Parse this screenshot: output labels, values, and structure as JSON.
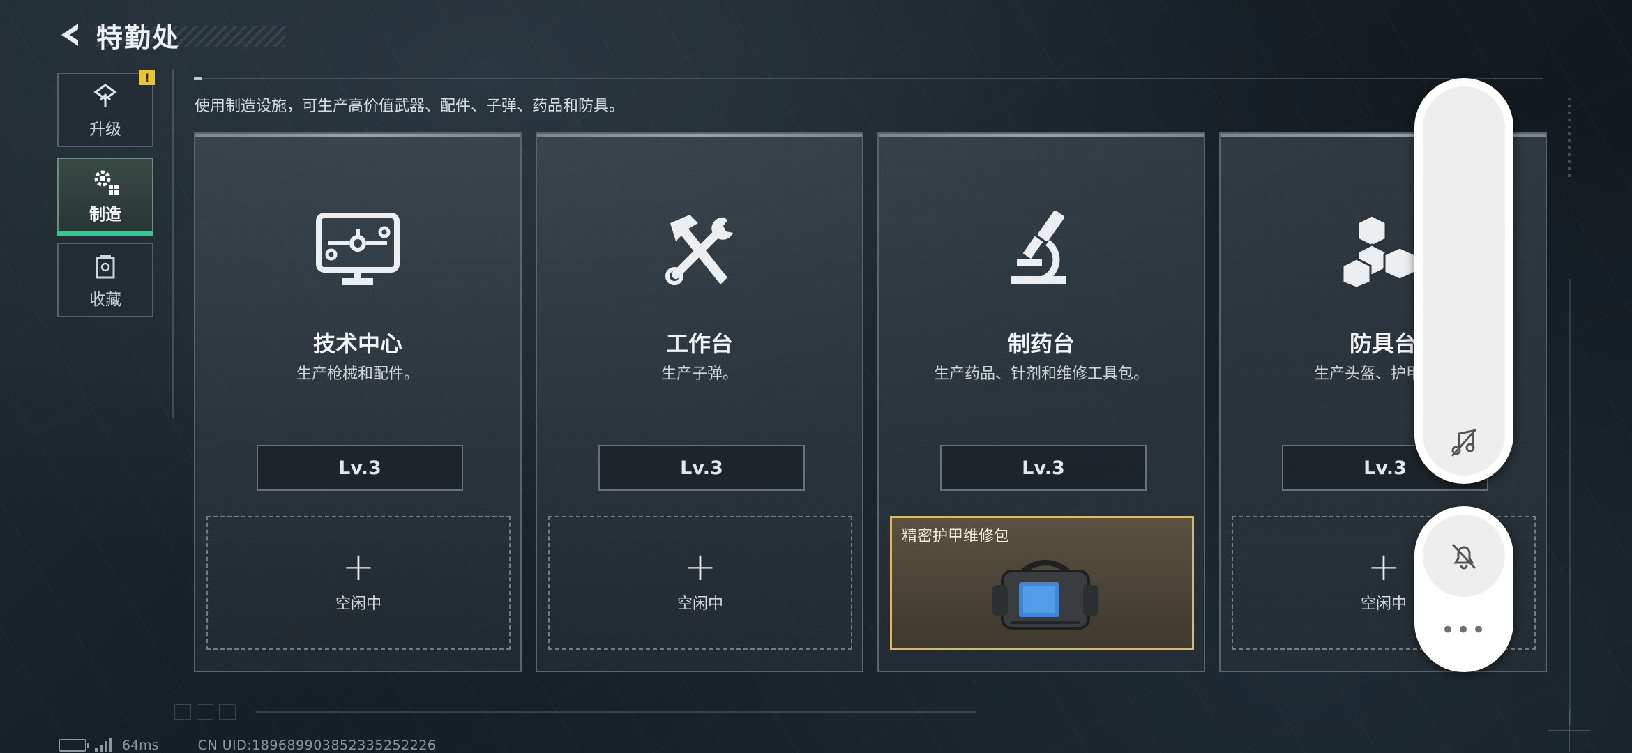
{
  "header": {
    "title": "特勤处"
  },
  "sidebar": {
    "items": [
      {
        "label": "升级",
        "icon": "upgrade-icon",
        "badge": "!",
        "active": false
      },
      {
        "label": "制造",
        "icon": "gear-icon",
        "active": true
      },
      {
        "label": "收藏",
        "icon": "collection-icon",
        "active": false
      }
    ]
  },
  "description": "使用制造设施，可生产高价值武器、配件、子弹、药品和防具。",
  "cards": [
    {
      "title": "技术中心",
      "desc": "生产枪械和配件。",
      "level": "Lv.3",
      "icon": "monitor-circuit-icon",
      "slot": {
        "state": "idle",
        "plus": "+",
        "label": "空闲中"
      }
    },
    {
      "title": "工作台",
      "desc": "生产子弹。",
      "level": "Lv.3",
      "icon": "hammer-wrench-icon",
      "slot": {
        "state": "idle",
        "plus": "+",
        "label": "空闲中"
      }
    },
    {
      "title": "制药台",
      "desc": "生产药品、针剂和维修工具包。",
      "level": "Lv.3",
      "icon": "microscope-icon",
      "slot": {
        "state": "producing",
        "item_name": "精密护甲维修包",
        "item_icon": "repair-kit-bag-icon"
      }
    },
    {
      "title": "防具台",
      "desc": "生产头盔、护甲、胸",
      "level": "Lv.3",
      "icon": "cubes-icon",
      "slot": {
        "state": "idle",
        "plus": "+",
        "label": "空闲中"
      }
    }
  ],
  "overlay": {
    "music_button_icon": "music-off-icon",
    "bell_button_icon": "bell-off-icon",
    "more_label": "•••"
  },
  "status": {
    "ping": "64ms",
    "uid": "CN UID:189689903852335252226"
  },
  "colors": {
    "accent_green": "#36c890",
    "badge_yellow": "#e8c531",
    "producing_border": "#d8b968"
  }
}
